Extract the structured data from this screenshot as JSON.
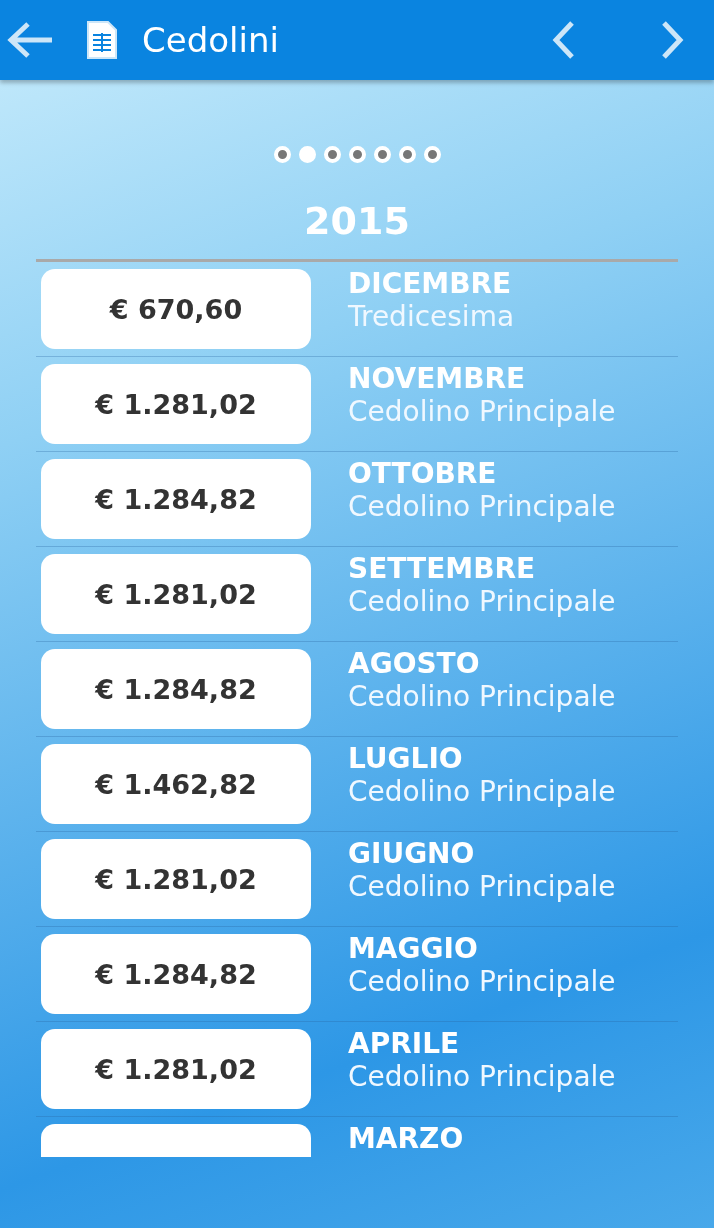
{
  "header": {
    "title": "Cedolini"
  },
  "pager": [
    {
      "selected": false
    },
    {
      "selected": true
    },
    {
      "selected": false
    },
    {
      "selected": false
    },
    {
      "selected": false
    },
    {
      "selected": false
    },
    {
      "selected": false
    }
  ],
  "year": "2015",
  "payslips": [
    {
      "amount": "€ 670,60",
      "month": "DICEMBRE",
      "type": "Tredicesima"
    },
    {
      "amount": "€ 1.281,02",
      "month": "NOVEMBRE",
      "type": "Cedolino Principale"
    },
    {
      "amount": "€ 1.284,82",
      "month": "OTTOBRE",
      "type": "Cedolino Principale"
    },
    {
      "amount": "€ 1.281,02",
      "month": "SETTEMBRE",
      "type": "Cedolino Principale"
    },
    {
      "amount": "€ 1.284,82",
      "month": "AGOSTO",
      "type": "Cedolino Principale"
    },
    {
      "amount": "€ 1.462,82",
      "month": "LUGLIO",
      "type": "Cedolino Principale"
    },
    {
      "amount": "€ 1.281,02",
      "month": "GIUGNO",
      "type": "Cedolino Principale"
    },
    {
      "amount": "€ 1.284,82",
      "month": "MAGGIO",
      "type": "Cedolino Principale"
    },
    {
      "amount": "€ 1.281,02",
      "month": "APRILE",
      "type": "Cedolino Principale"
    },
    {
      "month": "MARZO"
    }
  ]
}
